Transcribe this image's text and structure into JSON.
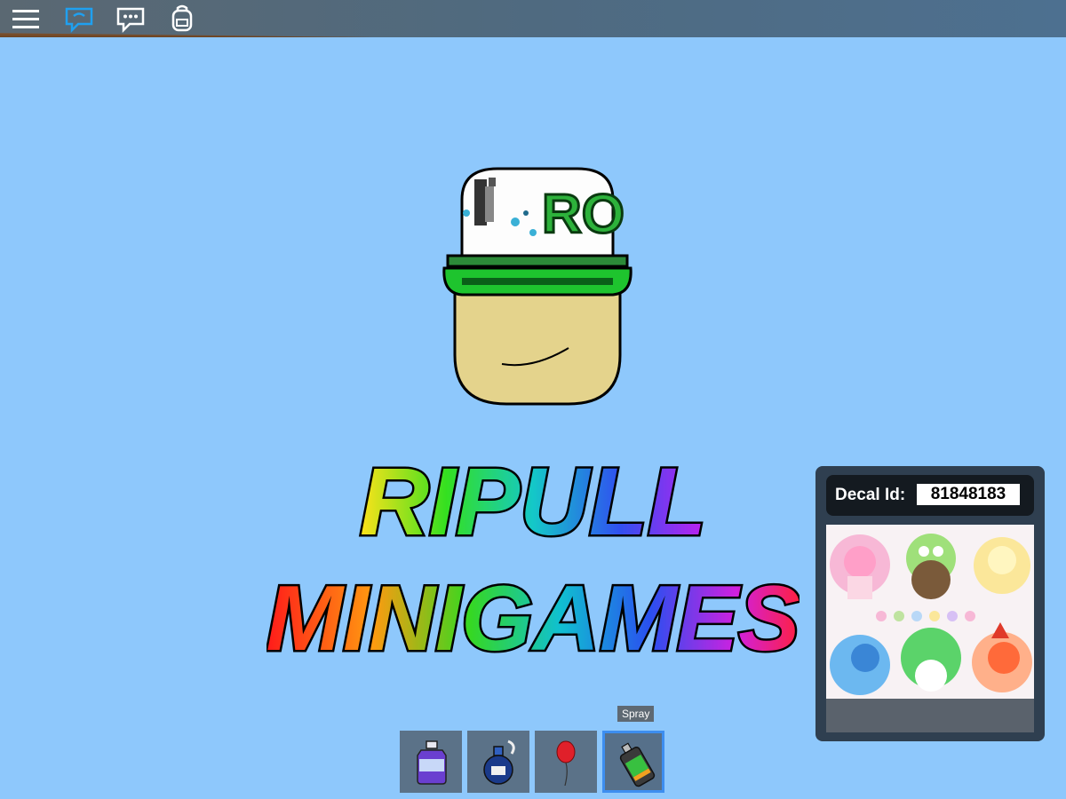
{
  "topbar": {
    "icons": [
      "menu-icon",
      "chat-icon",
      "chat-bubble-icon",
      "backpack-icon"
    ]
  },
  "logo": {
    "line1": "RIPULL",
    "line2": "MINIGAMES"
  },
  "hat": {
    "text": "RO"
  },
  "decal": {
    "label": "Decal Id:",
    "value": "81848183"
  },
  "hotbar": {
    "tooltip": "Spray",
    "selected_slot": 4,
    "slots": [
      {
        "icon": "bottle-icon"
      },
      {
        "icon": "potion-icon"
      },
      {
        "icon": "balloon-icon"
      },
      {
        "icon": "spray-can-icon"
      }
    ]
  },
  "colors": {
    "sky": "#8ec8fc",
    "topbar": "#4f6a80",
    "panel": "#2f3f50",
    "accent": "#3d8ef0"
  }
}
